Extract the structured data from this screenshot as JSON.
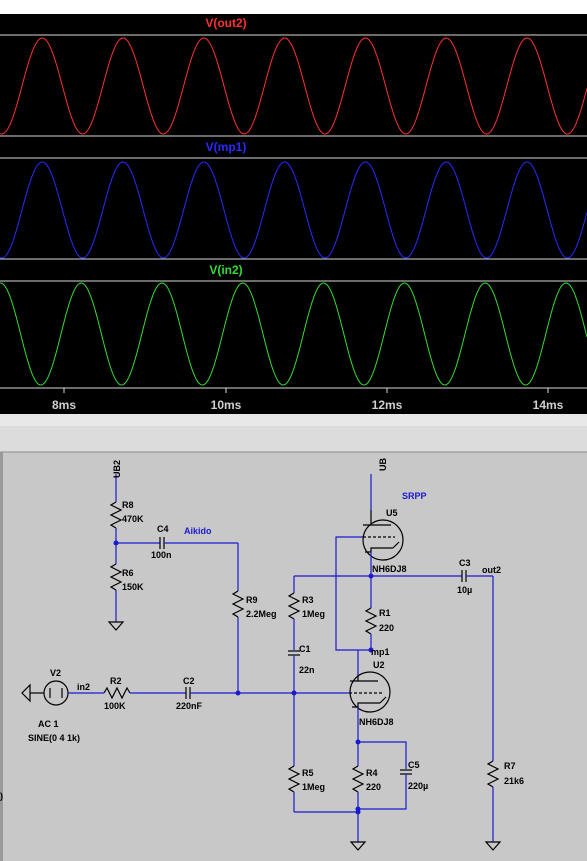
{
  "waveform": {
    "traces": [
      {
        "name": "V(out2)",
        "color": "#ff3030"
      },
      {
        "name": "V(mp1)",
        "color": "#2a2aff"
      },
      {
        "name": "V(in2)",
        "color": "#33dd33"
      }
    ],
    "x_ticks": [
      "8ms",
      "10ms",
      "12ms",
      "14ms"
    ],
    "background": "#000000"
  },
  "schematic": {
    "labels": {
      "ub2": "UB2",
      "ub": "UB",
      "srpp": "SRPP",
      "aikido": "Aikido",
      "r8": "R8",
      "r8_val": "470K",
      "c4": "C4",
      "c4_val": "100n",
      "r6": "R6",
      "r6_val": "150K",
      "r9": "R9",
      "r9_val": "2.2Meg",
      "r3": "R3",
      "r3_val": "1Meg",
      "u5": "U5",
      "u5_model": "NH6DJ8",
      "c3": "C3",
      "c3_val": "10µ",
      "out2": "out2",
      "r1": "R1",
      "r1_val": "220",
      "c1": "C1",
      "c1_val": "22n",
      "mp1": "mp1",
      "u2": "U2",
      "u2_model": "NH6DJ8",
      "v2": "V2",
      "in2": "in2",
      "r2": "R2",
      "r2_val": "100K",
      "c2": "C2",
      "c2_val": "220nF",
      "v2_ac": "AC 1",
      "v2_sine": "SINE(0 4 1k)",
      "c5": "C5",
      "c5_val": "220µ",
      "r4": "R4",
      "r4_val": "220",
      "r5": "R5",
      "r5_val": "1Meg",
      "r7": "R7",
      "r7_val": "21k6",
      "edge": ")"
    },
    "wire_color": "#1a1ad0",
    "background": "#c8c8c8"
  }
}
